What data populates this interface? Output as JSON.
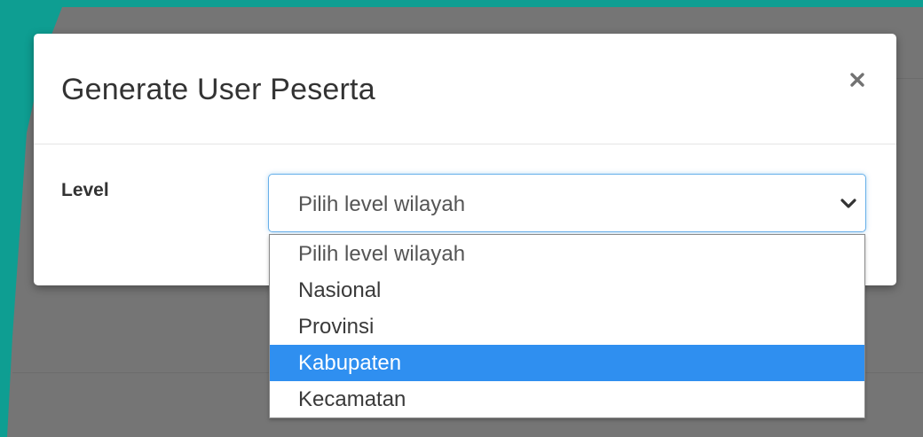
{
  "modal": {
    "title": "Generate User Peserta",
    "close_icon": "close-icon"
  },
  "form": {
    "level_label": "Level",
    "level_select": {
      "value": "Pilih level wilayah",
      "icon": "chevron-down-icon"
    }
  },
  "dropdown": {
    "options": [
      {
        "label": "Pilih level wilayah",
        "highlighted": false
      },
      {
        "label": "Nasional",
        "highlighted": false
      },
      {
        "label": "Provinsi",
        "highlighted": false
      },
      {
        "label": "Kabupaten",
        "highlighted": true
      },
      {
        "label": "Kecamatan",
        "highlighted": false
      }
    ]
  },
  "colors": {
    "outer_background": "#0e9e92",
    "overlay": "#757575",
    "highlight": "#2f8ff0",
    "focus_border": "#66afe9"
  }
}
